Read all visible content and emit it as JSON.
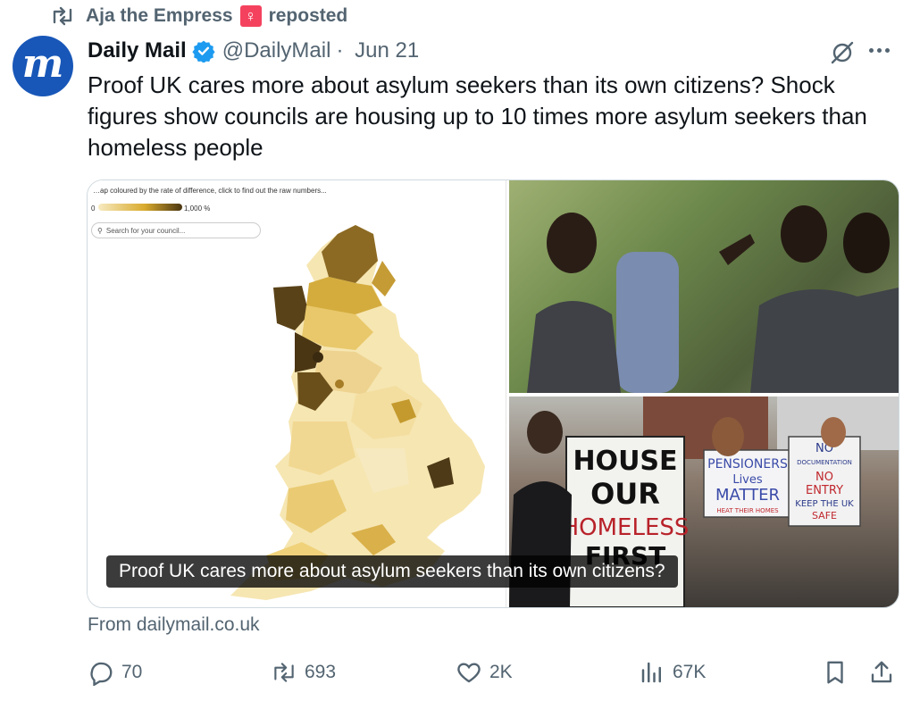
{
  "repost": {
    "user": "Aja the Empress",
    "female_sign": "♀",
    "suffix": "reposted"
  },
  "post": {
    "avatar_letter": "m",
    "name": "Daily Mail",
    "handle": "@DailyMail",
    "separator": "·",
    "date": "Jun 21",
    "text": "Proof UK cares more about asylum seekers than its own citizens? Shock figures show councils are housing up to 10 times more asylum seekers than homeless people"
  },
  "card": {
    "map_caption": "…ap coloured by the rate of difference, click to find out the raw numbers...",
    "legend_min": "0",
    "legend_max": "1,000 %",
    "search_placeholder": "Search for your council...",
    "sign_house": [
      "HOUSE",
      "OUR",
      "HOMELESS",
      "FIRST"
    ],
    "sign_pensioners": [
      "PENSIONERS",
      "Lives",
      "MATTER",
      "HEAT THEIR HOMES"
    ],
    "sign_no_doc": [
      "NO",
      "DOCUMENTATION",
      "NO",
      "ENTRY",
      "KEEP THE UK",
      "SAFE"
    ],
    "caption": "Proof UK cares more about asylum seekers than its own citizens?",
    "source": "From dailymail.co.uk"
  },
  "actions": {
    "replies": "70",
    "reposts": "693",
    "likes": "2K",
    "views": "67K"
  },
  "colors": {
    "accent": "#1d9bf0",
    "avatar": "#1857b8",
    "muted": "#536471",
    "female_badge": "#f4425e"
  }
}
